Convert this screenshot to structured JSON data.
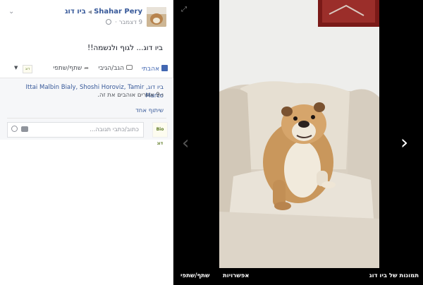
{
  "post": {
    "author": "Shahar Pery",
    "page": "ביו דוג",
    "date": "9 דצמבר",
    "date_dot": "·",
    "text": "ביו דוג... לגוף ולנשמה!!",
    "avatar_icon": "dog-photo-thumbnail"
  },
  "actions": {
    "like": "אהבתי",
    "comment": "הגב/הגיבי",
    "share": "שתף/שתפי",
    "page_badge": "דוג"
  },
  "likes": {
    "names": "ביו דוג, Ittai Malbin Bialy, Shoshi Horoviz, Tamir Marco",
    "others": "ו-9 אחרים אוהבים את זה.",
    "shares": "שיתוף אחד"
  },
  "comment_box": {
    "placeholder": "כתוב/כתבי תגובה...",
    "avatar_label": "Bio דוג"
  },
  "viewer": {
    "album_label": "תמונות של ביו דוג",
    "options_label": "אפשרויות",
    "share_label": "שתף/שתפי",
    "prev_glyph": "‹",
    "next_glyph": "›",
    "expand_glyph": "⤢"
  },
  "colors": {
    "link": "#365899",
    "like_blue": "#4267b2",
    "viewer_bg": "#000000"
  }
}
